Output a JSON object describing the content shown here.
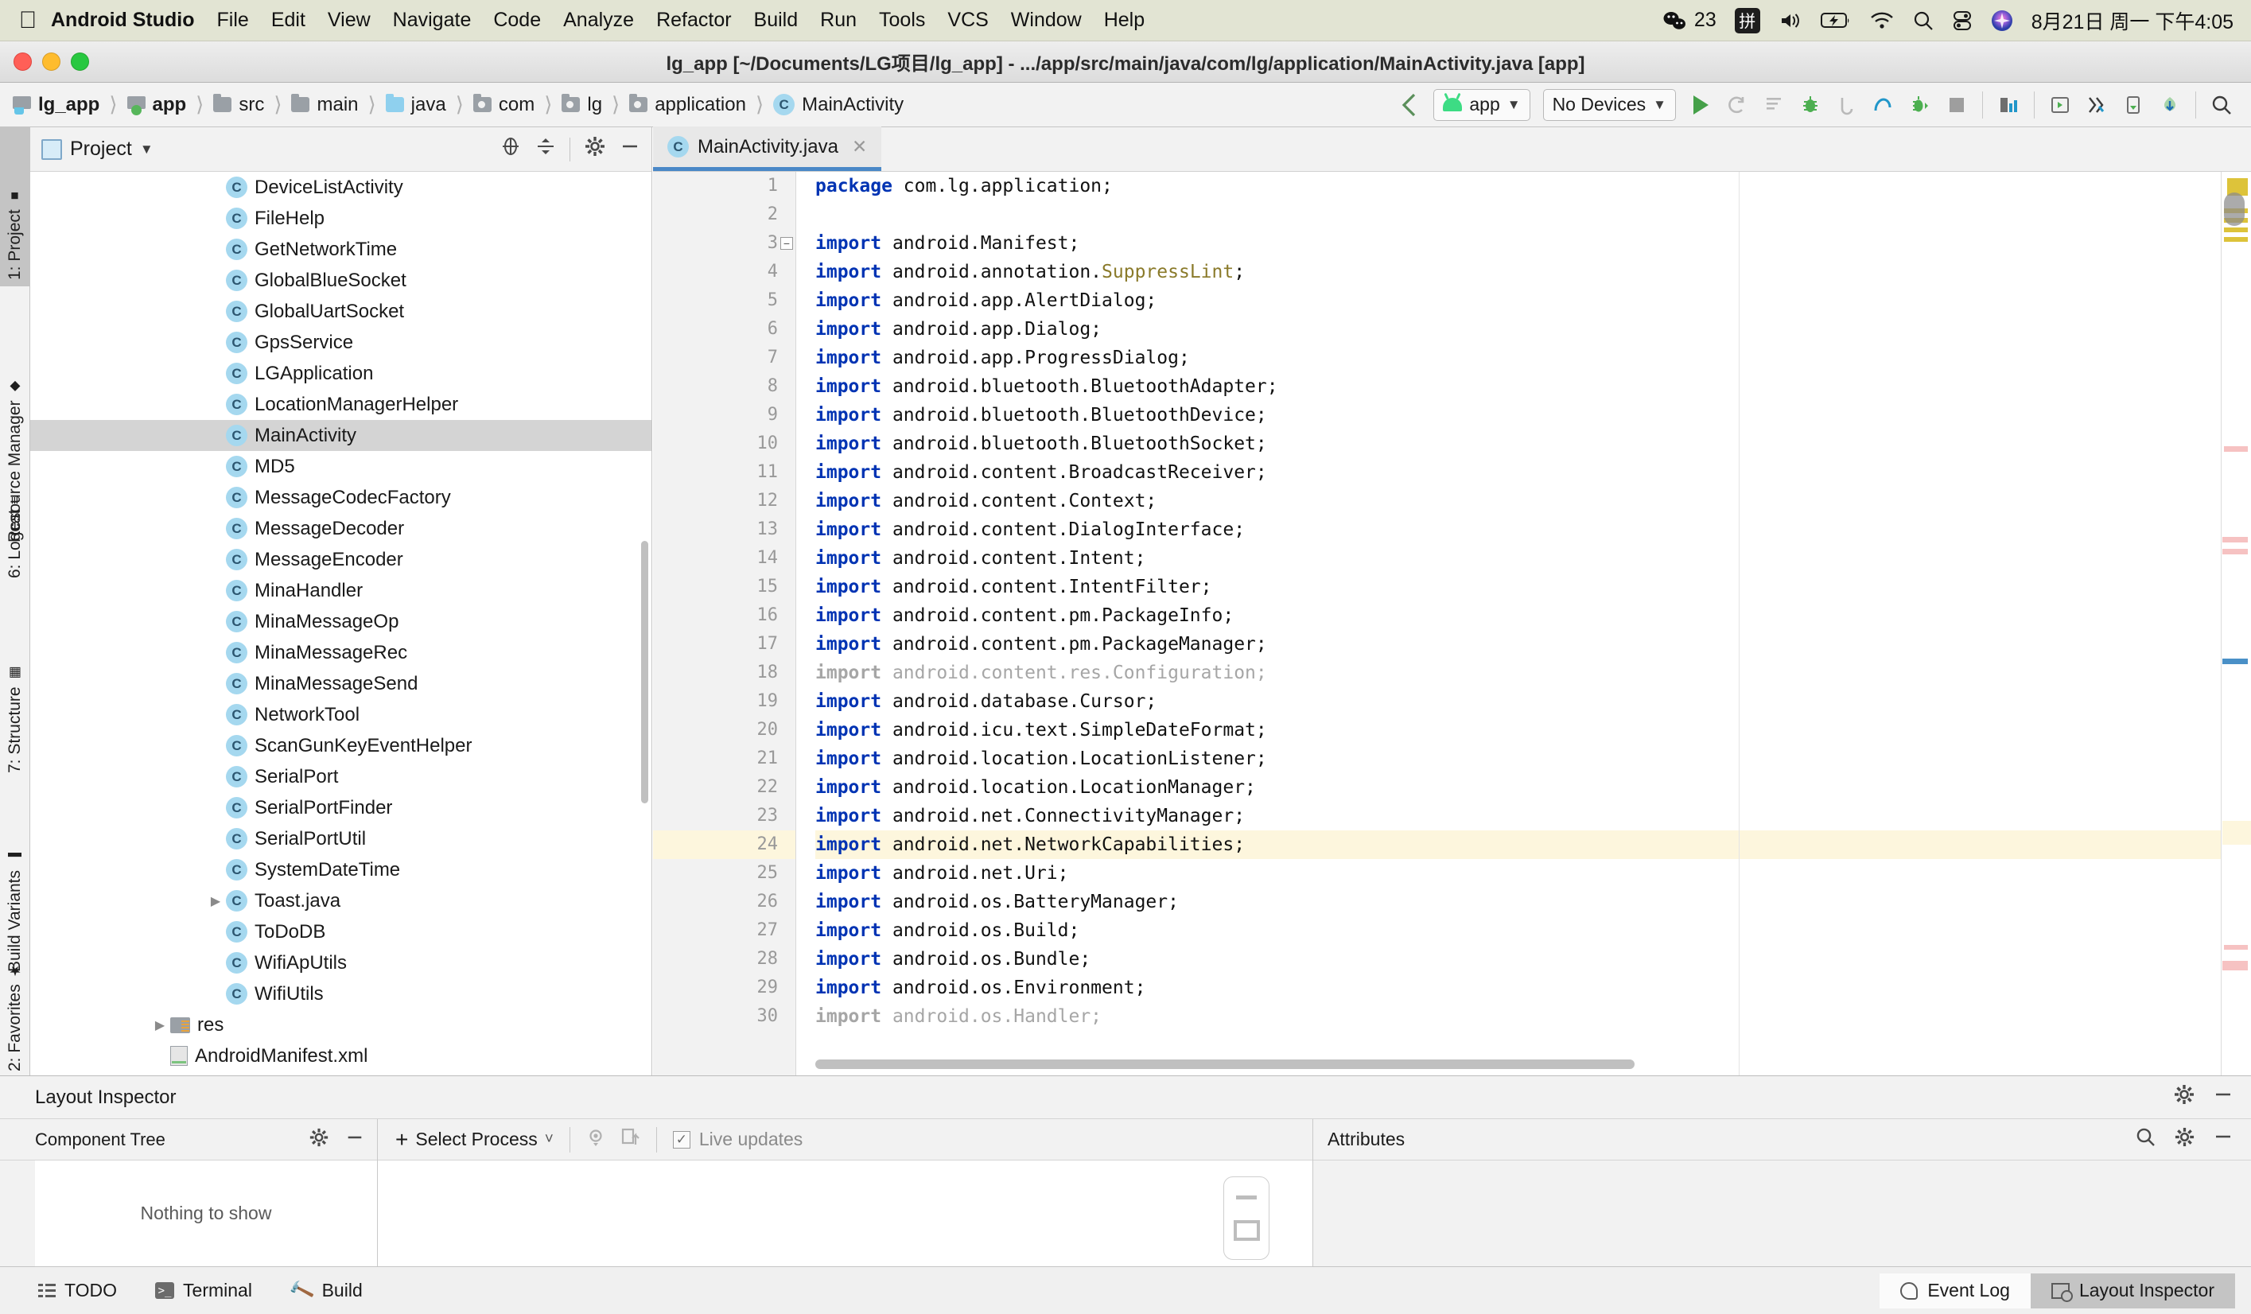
{
  "macbar": {
    "apple_icon": "apple-logo-icon",
    "app_name": "Android Studio",
    "menus": [
      "File",
      "Edit",
      "View",
      "Navigate",
      "Code",
      "Analyze",
      "Refactor",
      "Build",
      "Run",
      "Tools",
      "VCS",
      "Window",
      "Help"
    ],
    "wechat_count": "23",
    "ime_label": "拼",
    "clock": "8月21日 周一 下午4:05",
    "status_icons": [
      "wechat-icon",
      "ime-icon",
      "volume-icon",
      "battery-icon",
      "wifi-icon",
      "spotlight-search-icon",
      "control-center-icon",
      "siri-icon"
    ]
  },
  "window": {
    "title": "lg_app [~/Documents/LG项目/lg_app] - .../app/src/main/java/com/lg/application/MainActivity.java [app]"
  },
  "breadcrumb": [
    {
      "label": "lg_app",
      "icon": "project-module-icon",
      "bold": true
    },
    {
      "label": "app",
      "icon": "android-module-icon",
      "bold": true
    },
    {
      "label": "src",
      "icon": "folder-icon",
      "bold": false
    },
    {
      "label": "main",
      "icon": "folder-icon",
      "bold": false
    },
    {
      "label": "java",
      "icon": "source-folder-icon",
      "bold": false
    },
    {
      "label": "com",
      "icon": "package-icon",
      "bold": false
    },
    {
      "label": "lg",
      "icon": "package-icon",
      "bold": false
    },
    {
      "label": "application",
      "icon": "package-icon",
      "bold": false
    },
    {
      "label": "MainActivity",
      "icon": "java-class-icon",
      "bold": false
    }
  ],
  "toolbar": {
    "back_arrow_icon": "back-arrow-icon",
    "run_config": "app",
    "device_selector": "No Devices",
    "buttons": [
      "run-icon",
      "rerun-icon",
      "apply-changes-icon",
      "debug-icon",
      "attach-debugger-icon",
      "profiler-icon",
      "run-coverage-icon",
      "stop-icon",
      "sdk-manager-icon",
      "avd-manager-icon",
      "layout-inspector-icon",
      "device-file-explorer-icon",
      "sync-gradle-icon",
      "search-icon"
    ]
  },
  "left_tabs": [
    {
      "label": "1: Project",
      "active": true,
      "icon": "project-tab-icon"
    },
    {
      "label": "Resource Manager",
      "active": false,
      "icon": "resource-manager-icon"
    },
    {
      "label": "6: Logcat",
      "active": false,
      "icon": "logcat-icon"
    },
    {
      "label": "7: Structure",
      "active": false,
      "icon": "structure-icon"
    },
    {
      "label": "Build Variants",
      "active": false,
      "icon": "build-variants-icon"
    },
    {
      "label": "2: Favorites",
      "active": false,
      "icon": "favorites-star-icon"
    }
  ],
  "project_panel": {
    "title": "Project",
    "dropdown_icon": "chevron-down-icon",
    "actions": [
      "locate-icon",
      "collapse-all-icon",
      "settings-gear-icon",
      "minimize-icon"
    ],
    "tree": [
      {
        "label": "DeviceListActivity",
        "icon": "java-class-icon",
        "indent": 2,
        "arrow": false,
        "selected": false
      },
      {
        "label": "FileHelp",
        "icon": "java-class-icon",
        "indent": 2,
        "arrow": false,
        "selected": false
      },
      {
        "label": "GetNetworkTime",
        "icon": "java-class-icon",
        "indent": 2,
        "arrow": false,
        "selected": false
      },
      {
        "label": "GlobalBlueSocket",
        "icon": "java-class-icon",
        "indent": 2,
        "arrow": false,
        "selected": false
      },
      {
        "label": "GlobalUartSocket",
        "icon": "java-class-icon",
        "indent": 2,
        "arrow": false,
        "selected": false
      },
      {
        "label": "GpsService",
        "icon": "java-class-icon",
        "indent": 2,
        "arrow": false,
        "selected": false
      },
      {
        "label": "LGApplication",
        "icon": "java-class-icon",
        "indent": 2,
        "arrow": false,
        "selected": false
      },
      {
        "label": "LocationManagerHelper",
        "icon": "java-class-icon",
        "indent": 2,
        "arrow": false,
        "selected": false
      },
      {
        "label": "MainActivity",
        "icon": "java-class-icon",
        "indent": 2,
        "arrow": false,
        "selected": true
      },
      {
        "label": "MD5",
        "icon": "java-class-icon",
        "indent": 2,
        "arrow": false,
        "selected": false
      },
      {
        "label": "MessageCodecFactory",
        "icon": "java-class-icon",
        "indent": 2,
        "arrow": false,
        "selected": false
      },
      {
        "label": "MessageDecoder",
        "icon": "java-class-icon",
        "indent": 2,
        "arrow": false,
        "selected": false
      },
      {
        "label": "MessageEncoder",
        "icon": "java-class-icon",
        "indent": 2,
        "arrow": false,
        "selected": false
      },
      {
        "label": "MinaHandler",
        "icon": "java-class-icon",
        "indent": 2,
        "arrow": false,
        "selected": false
      },
      {
        "label": "MinaMessageOp",
        "icon": "java-class-icon",
        "indent": 2,
        "arrow": false,
        "selected": false
      },
      {
        "label": "MinaMessageRec",
        "icon": "java-class-icon",
        "indent": 2,
        "arrow": false,
        "selected": false
      },
      {
        "label": "MinaMessageSend",
        "icon": "java-class-icon",
        "indent": 2,
        "arrow": false,
        "selected": false
      },
      {
        "label": "NetworkTool",
        "icon": "java-class-icon",
        "indent": 2,
        "arrow": false,
        "selected": false
      },
      {
        "label": "ScanGunKeyEventHelper",
        "icon": "java-class-icon",
        "indent": 2,
        "arrow": false,
        "selected": false
      },
      {
        "label": "SerialPort",
        "icon": "java-class-icon",
        "indent": 2,
        "arrow": false,
        "selected": false
      },
      {
        "label": "SerialPortFinder",
        "icon": "java-class-icon",
        "indent": 2,
        "arrow": false,
        "selected": false
      },
      {
        "label": "SerialPortUtil",
        "icon": "java-class-icon",
        "indent": 2,
        "arrow": false,
        "selected": false
      },
      {
        "label": "SystemDateTime",
        "icon": "java-class-icon",
        "indent": 2,
        "arrow": false,
        "selected": false
      },
      {
        "label": "Toast.java",
        "icon": "java-class-icon",
        "indent": 2,
        "arrow": true,
        "selected": false
      },
      {
        "label": "ToDoDB",
        "icon": "java-class-icon",
        "indent": 2,
        "arrow": false,
        "selected": false
      },
      {
        "label": "WifiApUtils",
        "icon": "java-class-icon",
        "indent": 2,
        "arrow": false,
        "selected": false
      },
      {
        "label": "WifiUtils",
        "icon": "java-class-icon",
        "indent": 2,
        "arrow": false,
        "selected": false
      },
      {
        "label": "res",
        "icon": "res-folder-icon",
        "indent": 1,
        "arrow": true,
        "selected": false
      },
      {
        "label": "AndroidManifest.xml",
        "icon": "xml-file-icon",
        "indent": 1,
        "arrow": false,
        "selected": false
      }
    ]
  },
  "editor": {
    "tab": {
      "label": "MainActivity.java",
      "icon": "java-class-icon",
      "close_icon": "close-icon"
    },
    "lines": [
      {
        "n": "1",
        "segments": [
          {
            "t": "package ",
            "c": "kw"
          },
          {
            "t": "com.lg.application;",
            "c": ""
          }
        ]
      },
      {
        "n": "2",
        "segments": []
      },
      {
        "n": "3",
        "segments": [
          {
            "t": "import ",
            "c": "kw"
          },
          {
            "t": "android.Manifest;",
            "c": ""
          }
        ],
        "fold": true
      },
      {
        "n": "4",
        "segments": [
          {
            "t": "import ",
            "c": "kw"
          },
          {
            "t": "android.annotation.",
            "c": ""
          },
          {
            "t": "SuppressLint",
            "c": "cls"
          },
          {
            "t": ";",
            "c": ""
          }
        ]
      },
      {
        "n": "5",
        "segments": [
          {
            "t": "import ",
            "c": "kw"
          },
          {
            "t": "android.app.AlertDialog;",
            "c": ""
          }
        ]
      },
      {
        "n": "6",
        "segments": [
          {
            "t": "import ",
            "c": "kw"
          },
          {
            "t": "android.app.Dialog;",
            "c": ""
          }
        ]
      },
      {
        "n": "7",
        "segments": [
          {
            "t": "import ",
            "c": "kw"
          },
          {
            "t": "android.app.ProgressDialog;",
            "c": ""
          }
        ]
      },
      {
        "n": "8",
        "segments": [
          {
            "t": "import ",
            "c": "kw"
          },
          {
            "t": "android.bluetooth.BluetoothAdapter;",
            "c": ""
          }
        ]
      },
      {
        "n": "9",
        "segments": [
          {
            "t": "import ",
            "c": "kw"
          },
          {
            "t": "android.bluetooth.BluetoothDevice;",
            "c": ""
          }
        ]
      },
      {
        "n": "10",
        "segments": [
          {
            "t": "import ",
            "c": "kw"
          },
          {
            "t": "android.bluetooth.BluetoothSocket;",
            "c": ""
          }
        ]
      },
      {
        "n": "11",
        "segments": [
          {
            "t": "import ",
            "c": "kw"
          },
          {
            "t": "android.content.BroadcastReceiver;",
            "c": ""
          }
        ]
      },
      {
        "n": "12",
        "segments": [
          {
            "t": "import ",
            "c": "kw"
          },
          {
            "t": "android.content.Context;",
            "c": ""
          }
        ]
      },
      {
        "n": "13",
        "segments": [
          {
            "t": "import ",
            "c": "kw"
          },
          {
            "t": "android.content.DialogInterface;",
            "c": ""
          }
        ]
      },
      {
        "n": "14",
        "segments": [
          {
            "t": "import ",
            "c": "kw"
          },
          {
            "t": "android.content.Intent;",
            "c": ""
          }
        ]
      },
      {
        "n": "15",
        "segments": [
          {
            "t": "import ",
            "c": "kw"
          },
          {
            "t": "android.content.IntentFilter;",
            "c": ""
          }
        ]
      },
      {
        "n": "16",
        "segments": [
          {
            "t": "import ",
            "c": "kw"
          },
          {
            "t": "android.content.pm.PackageInfo;",
            "c": ""
          }
        ]
      },
      {
        "n": "17",
        "segments": [
          {
            "t": "import ",
            "c": "kw"
          },
          {
            "t": "android.content.pm.PackageManager;",
            "c": ""
          }
        ]
      },
      {
        "n": "18",
        "segments": [
          {
            "t": "import ",
            "c": "dimkw"
          },
          {
            "t": "android.content.res.Configuration;",
            "c": "dim"
          }
        ]
      },
      {
        "n": "19",
        "segments": [
          {
            "t": "import ",
            "c": "kw"
          },
          {
            "t": "android.database.Cursor;",
            "c": ""
          }
        ]
      },
      {
        "n": "20",
        "segments": [
          {
            "t": "import ",
            "c": "kw"
          },
          {
            "t": "android.icu.text.SimpleDateFormat;",
            "c": ""
          }
        ]
      },
      {
        "n": "21",
        "segments": [
          {
            "t": "import ",
            "c": "kw"
          },
          {
            "t": "android.location.LocationListener;",
            "c": ""
          }
        ]
      },
      {
        "n": "22",
        "segments": [
          {
            "t": "import ",
            "c": "kw"
          },
          {
            "t": "android.location.LocationManager;",
            "c": ""
          }
        ]
      },
      {
        "n": "23",
        "segments": [
          {
            "t": "import ",
            "c": "kw"
          },
          {
            "t": "android.net.ConnectivityManager;",
            "c": ""
          }
        ]
      },
      {
        "n": "24",
        "segments": [
          {
            "t": "import ",
            "c": "kw"
          },
          {
            "t": "android.net.NetworkCapabilities;",
            "c": ""
          }
        ],
        "highlight": true
      },
      {
        "n": "25",
        "segments": [
          {
            "t": "import ",
            "c": "kw"
          },
          {
            "t": "android.net.Uri;",
            "c": ""
          }
        ]
      },
      {
        "n": "26",
        "segments": [
          {
            "t": "import ",
            "c": "kw"
          },
          {
            "t": "android.os.BatteryManager;",
            "c": ""
          }
        ]
      },
      {
        "n": "27",
        "segments": [
          {
            "t": "import ",
            "c": "kw"
          },
          {
            "t": "android.os.Build;",
            "c": ""
          }
        ]
      },
      {
        "n": "28",
        "segments": [
          {
            "t": "import ",
            "c": "kw"
          },
          {
            "t": "android.os.Bundle;",
            "c": ""
          }
        ]
      },
      {
        "n": "29",
        "segments": [
          {
            "t": "import ",
            "c": "kw"
          },
          {
            "t": "android.os.Environment;",
            "c": ""
          }
        ]
      },
      {
        "n": "30",
        "segments": [
          {
            "t": "import ",
            "c": "dimkw"
          },
          {
            "t": "android.os.Handler;",
            "c": "dim"
          }
        ]
      }
    ]
  },
  "layout_inspector": {
    "panel_title": "Layout Inspector",
    "panel_actions": [
      "settings-gear-icon",
      "minimize-icon"
    ],
    "component_tree": {
      "title": "Component Tree",
      "actions": [
        "settings-gear-icon",
        "minimize-icon"
      ],
      "empty_text": "Nothing to show"
    },
    "process_selector": {
      "plus": "+",
      "label": "Select Process",
      "caret_icon": "chevron-down-icon"
    },
    "center_icons": [
      "eye-icon",
      "copy-layer-icon"
    ],
    "live_updates": {
      "label": "Live updates",
      "checked": true,
      "check_icon": "checkmark-icon"
    },
    "zoom_controls": [
      "zoom-out-icon",
      "zoom-to-fit-icon"
    ],
    "attributes": {
      "title": "Attributes",
      "actions": [
        "search-icon",
        "settings-gear-icon",
        "minimize-icon"
      ]
    }
  },
  "statusbar": {
    "left_items": [
      {
        "label": "TODO",
        "icon": "todo-icon"
      },
      {
        "label": "Terminal",
        "icon": "terminal-icon"
      },
      {
        "label": "Build",
        "icon": "build-hammer-icon"
      }
    ],
    "right_items": [
      {
        "label": "Event Log",
        "icon": "event-log-icon",
        "active": false
      },
      {
        "label": "Layout Inspector",
        "icon": "layout-inspector-icon",
        "active": true
      }
    ]
  },
  "colors": {
    "menubar_bg": "#e2e4d3",
    "accent_blue": "#4a88c7",
    "keyword_blue": "#0033b3",
    "class_olive": "#8a7a2a",
    "highlight_line": "#fdf6dd",
    "selection_gray": "#d4d4d4",
    "android_green": "#3ddc84"
  }
}
